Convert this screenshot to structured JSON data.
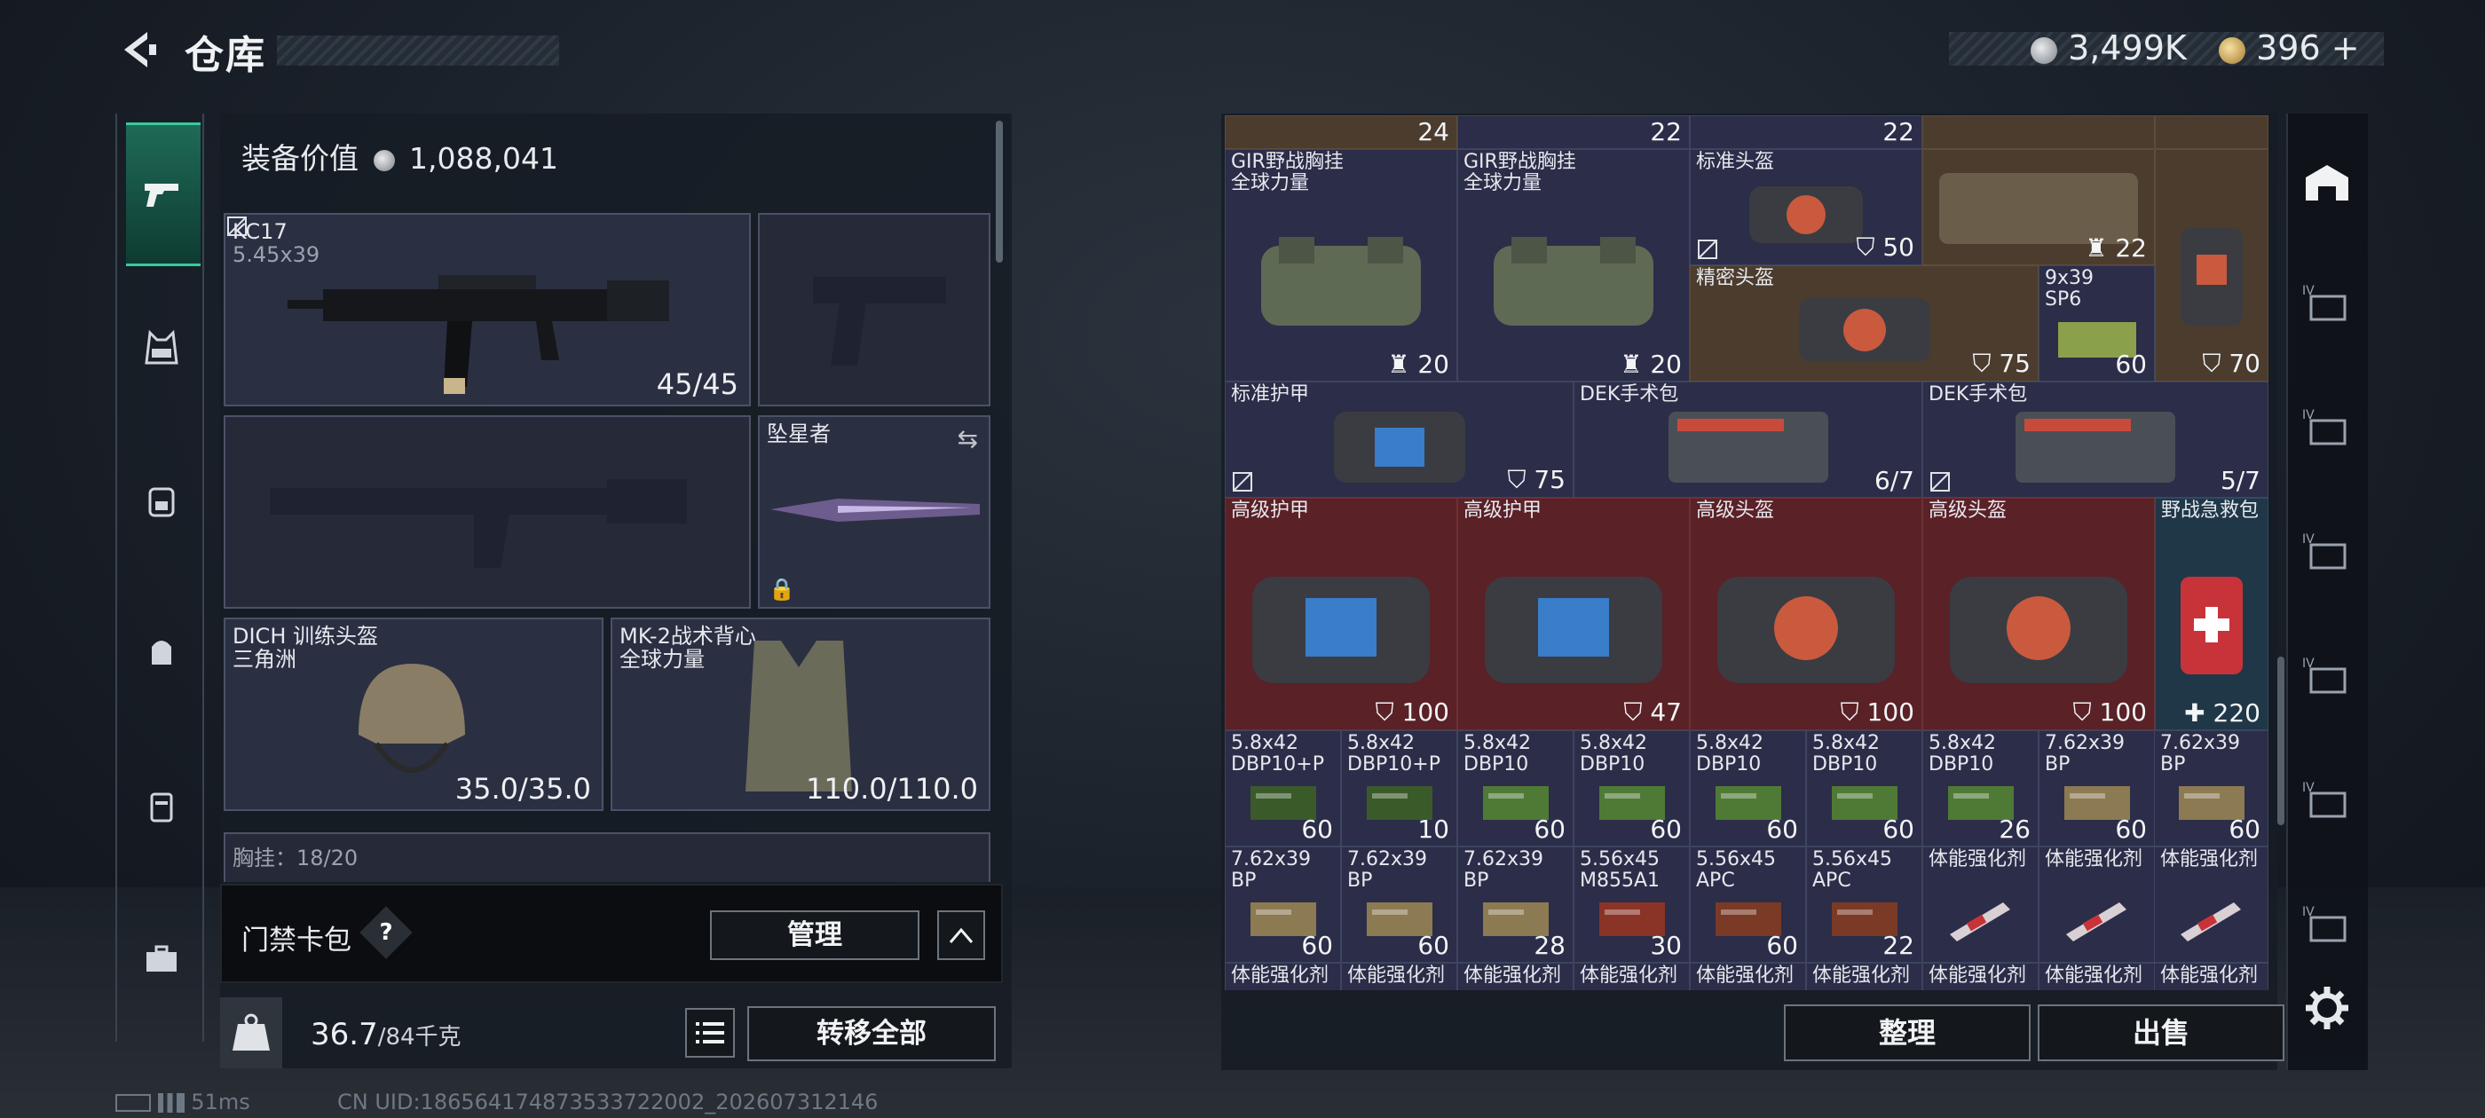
{
  "header": {
    "title": "仓库",
    "currency1": "3,499K",
    "currency2": "396",
    "plus": "+"
  },
  "left_panel": {
    "equip_value_label": "装备价值",
    "equip_value": "1,088,041",
    "weapon1_name": "KC17",
    "weapon1_caliber": "5.45x39",
    "weapon1_ammo": "45/45",
    "melee_name": "坠星者",
    "helmet_name": "DICH 训练头盔",
    "helmet_brand": "三角洲",
    "helmet_dur": "35.0/35.0",
    "vest_name": "MK-2战术背心",
    "vest_brand": "全球力量",
    "vest_dur": "110.0/110.0",
    "chest_partial": "胸挂：18/20"
  },
  "card_bag": {
    "label": "门禁卡包",
    "q": "?",
    "manage": "管理",
    "collapse": "︿"
  },
  "bottom": {
    "weight": "36.7",
    "weight_max": "/84千克",
    "transfer_all": "转移全部",
    "ping": "51ms",
    "uid": "CN UID:1865641748735337220​02_202607312146"
  },
  "grid": {
    "top_counts": [
      "24",
      "22",
      "22"
    ],
    "r1": [
      {
        "name": "GIR野战胸挂",
        "brand": "全球力量",
        "count": "20"
      },
      {
        "name": "GIR野战胸挂",
        "brand": "全球力量",
        "count": "20"
      },
      {
        "name": "标准头盔",
        "count": "50"
      },
      {
        "count": "22"
      },
      {
        "name": "精密头盔",
        "count": "75"
      },
      {
        "name": "9x39",
        "brand": "SP6",
        "count": "60"
      },
      {
        "count": "70"
      }
    ],
    "r2": [
      {
        "name": "标准护甲",
        "count": "75"
      },
      {
        "name": "DEK手术包",
        "count": "6/7"
      },
      {
        "name": "DEK手术包",
        "count": "5/7"
      }
    ],
    "r3": [
      {
        "name": "高级护甲",
        "count": "100"
      },
      {
        "name": "高级护甲",
        "count": "47"
      },
      {
        "name": "高级头盔",
        "count": "100"
      },
      {
        "name": "高级头盔",
        "count": "100"
      },
      {
        "name": "野战急救包",
        "count": "220"
      }
    ],
    "r4": [
      {
        "a": "5.8x42",
        "b": "DBP10+P",
        "count": "60"
      },
      {
        "a": "5.8x42",
        "b": "DBP10+P",
        "count": "10"
      },
      {
        "a": "5.8x42",
        "b": "DBP10",
        "count": "60"
      },
      {
        "a": "5.8x42",
        "b": "DBP10",
        "count": "60"
      },
      {
        "a": "5.8x42",
        "b": "DBP10",
        "count": "60"
      },
      {
        "a": "5.8x42",
        "b": "DBP10",
        "count": "60"
      },
      {
        "a": "5.8x42",
        "b": "DBP10",
        "count": "26"
      },
      {
        "a": "7.62x39",
        "b": "BP",
        "count": "60"
      },
      {
        "a": "7.62x39",
        "b": "BP",
        "count": "60"
      }
    ],
    "r5": [
      {
        "a": "7.62x39",
        "b": "BP",
        "count": "60"
      },
      {
        "a": "7.62x39",
        "b": "BP",
        "count": "60"
      },
      {
        "a": "7.62x39",
        "b": "BP",
        "count": "28"
      },
      {
        "a": "5.56x45",
        "b": "M855A1",
        "count": "30"
      },
      {
        "a": "5.56x45",
        "b": "APC",
        "count": "60"
      },
      {
        "a": "5.56x45",
        "b": "APC",
        "count": "22"
      },
      {
        "a": "体能强化剂",
        "b": "",
        "count": ""
      },
      {
        "a": "体能强化剂",
        "b": "",
        "count": ""
      },
      {
        "a": "体能强化剂",
        "b": "",
        "count": ""
      }
    ],
    "r6": [
      "体能强化剂",
      "体能强化剂",
      "体能强化剂",
      "体能强化剂",
      "体能强化剂",
      "体能强化剂",
      "体能强化剂",
      "体能强化剂",
      "体能强化剂"
    ]
  },
  "actions": {
    "sort": "整理",
    "sell": "出售"
  },
  "right_rail": [
    "IV",
    "IV",
    "IV",
    "IV",
    "IV",
    "IV"
  ],
  "colors": {
    "accent_green": "#38c9a0",
    "cell_purple": "#2c2d48",
    "cell_red": "#5a2127",
    "cell_blue": "#203748",
    "cell_tan": "#4b3c2e"
  }
}
